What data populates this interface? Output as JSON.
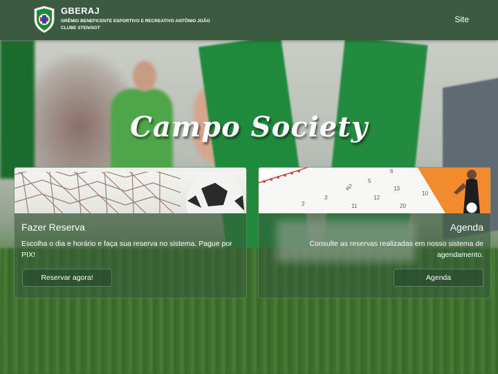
{
  "header": {
    "brand_title": "GBERAJ",
    "brand_subtitle": "GRÊMIO BENEFICENTE ESPORTIVO E RECREATIVO ANTÔNIO JOÃO CLUBE STEN/SGT",
    "site_link": "Site"
  },
  "hero": {
    "title": "Campo Society"
  },
  "cards": [
    {
      "title": "Fazer Reserva",
      "text": "Escolha o dia e horário e faça sua reserva no sistema. Pague por PIX!",
      "button": "Reservar agora!"
    },
    {
      "title": "Agenda",
      "text": "Consulte as reservas realizadas em nosso sistema de agendamento.",
      "button": "Agenda"
    }
  ],
  "calendar_numbers": [
    "2",
    "6",
    "4",
    "5",
    "3",
    "2",
    "13",
    "12",
    "11",
    "20",
    "10"
  ],
  "colors": {
    "header_bg": "#3b5a3f",
    "accent_green": "#1f8a3c",
    "card_bg": "rgba(55, 90, 58, 0.55)"
  },
  "icons": {
    "logo": "club-shield-logo"
  }
}
